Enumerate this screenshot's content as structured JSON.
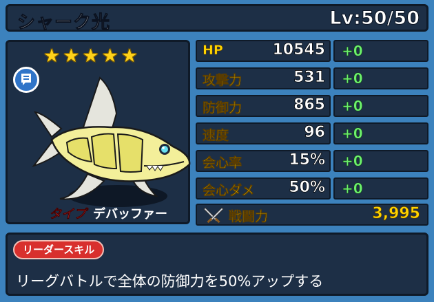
{
  "header": {
    "name": "シャーク光",
    "level": "Lv:50/50"
  },
  "character": {
    "stars": [
      "★",
      "★",
      "★",
      "★",
      "★"
    ],
    "type_label": "タイプ",
    "type_value": "デバッファー",
    "icons": {
      "memo": "memo-icon",
      "sprite": "shark-character"
    }
  },
  "stats": [
    {
      "label": "HP",
      "value": "10545",
      "bonus": "+0"
    },
    {
      "label": "攻撃力",
      "value": "531",
      "bonus": "+0"
    },
    {
      "label": "防御力",
      "value": "865",
      "bonus": "+0"
    },
    {
      "label": "速度",
      "value": "96",
      "bonus": "+0"
    },
    {
      "label": "会心率",
      "value": "15%",
      "bonus": "+0"
    },
    {
      "label": "会心ダメ",
      "value": "50%",
      "bonus": "+0"
    }
  ],
  "power": {
    "label": "戦闘力",
    "value": "3,995",
    "icon": "crossed-swords-icon"
  },
  "leader_skill": {
    "badge": "リーダースキル",
    "description": "リーグバトルで全体の防御力を50%アップする"
  },
  "colors": {
    "accent": "#ffd400",
    "bonus": "#6df06d",
    "panel": "#1d2f46",
    "background": "#3c82bd"
  }
}
